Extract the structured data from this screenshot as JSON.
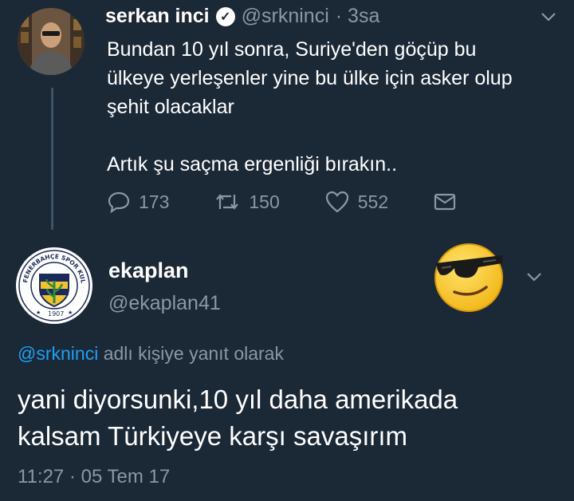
{
  "tweet1": {
    "author_name": "serkan inci",
    "handle": "@srkninci",
    "time": "· 3sa",
    "text": "Bundan 10 yıl sonra, Suriye'den göçüp bu\nülkeye yerleşenler yine bu ülke için asker olup\nşehit olacaklar\n\nArtık şu saçma ergenliği bırakın..",
    "replies": "173",
    "retweets": "150",
    "likes": "552"
  },
  "tweet2": {
    "author_name": "ekaplan",
    "handle": "@ekaplan41",
    "reply_mention": "@srkninci",
    "reply_suffix": " adlı kişiye yanıt olarak",
    "text": "yani diyorsunki,10 yıl daha amerikada\nkalsam Türkiyeye karşı savaşırım",
    "timestamp": "11:27 · 05 Tem 17",
    "avatar_logo": {
      "top_text": "FENERBAHÇE SPOR KULÜBÜ",
      "year": "1907"
    }
  },
  "icons": [
    "reply-icon",
    "retweet-icon",
    "like-icon",
    "direct-message-icon",
    "chevron-down-icon",
    "verified-icon",
    "sunglasses-emoji"
  ],
  "colors": {
    "background": "#1b2836",
    "muted": "#8899a6",
    "link": "#1da1f2"
  }
}
